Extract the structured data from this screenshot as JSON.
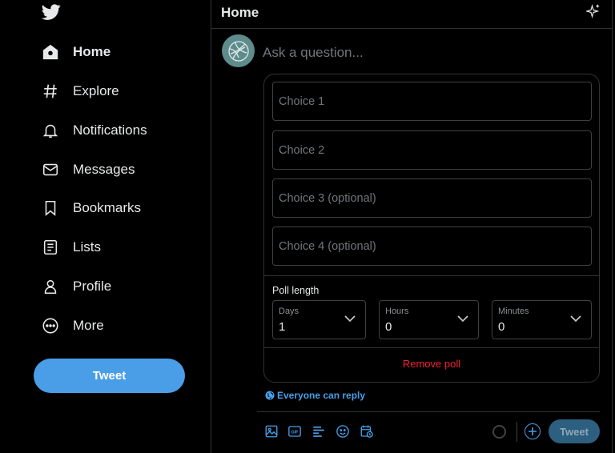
{
  "sidebar": {
    "items": [
      {
        "label": "Home",
        "icon": "home-icon"
      },
      {
        "label": "Explore",
        "icon": "hashtag-icon"
      },
      {
        "label": "Notifications",
        "icon": "bell-icon"
      },
      {
        "label": "Messages",
        "icon": "envelope-icon"
      },
      {
        "label": "Bookmarks",
        "icon": "bookmark-icon"
      },
      {
        "label": "Lists",
        "icon": "list-icon"
      },
      {
        "label": "Profile",
        "icon": "person-icon"
      },
      {
        "label": "More",
        "icon": "more-circle-icon"
      }
    ],
    "tweet_label": "Tweet"
  },
  "header": {
    "title": "Home"
  },
  "compose": {
    "question_placeholder": "Ask a question...",
    "poll": {
      "choices": [
        "Choice 1",
        "Choice 2",
        "Choice 3 (optional)",
        "Choice 4 (optional)"
      ],
      "length_label": "Poll length",
      "days": {
        "label": "Days",
        "value": "1"
      },
      "hours": {
        "label": "Hours",
        "value": "0"
      },
      "minutes": {
        "label": "Minutes",
        "value": "0"
      },
      "remove_label": "Remove poll"
    },
    "reply_setting": "Everyone can reply",
    "tweet_label": "Tweet"
  },
  "colors": {
    "accent": "#4a9ee8",
    "danger": "#f4212e",
    "background": "#000000"
  }
}
